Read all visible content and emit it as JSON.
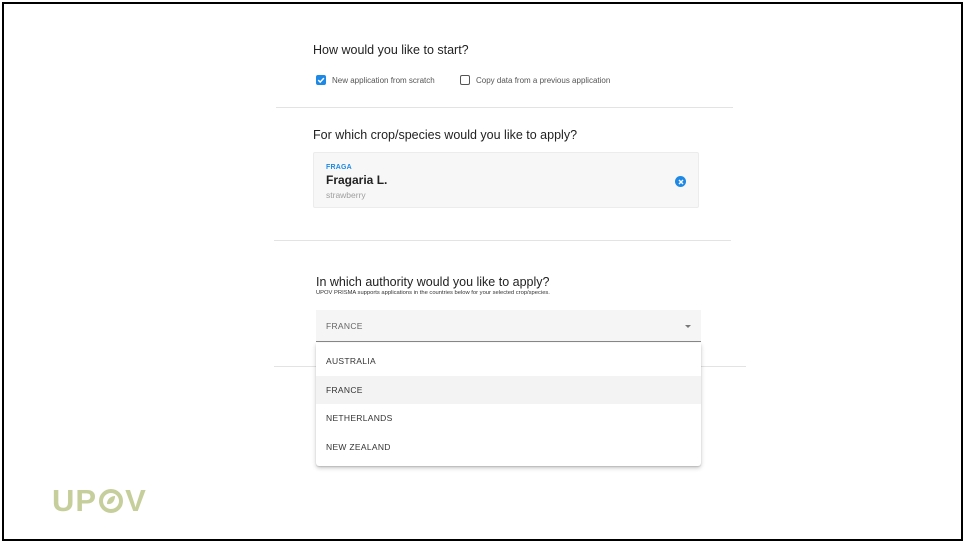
{
  "start": {
    "question": "How would you like to start?",
    "option_new": "New application from scratch",
    "option_copy": "Copy data from a previous application",
    "option_new_checked": true,
    "option_copy_checked": false
  },
  "crop": {
    "question": "For which crop/species would you like to apply?",
    "code": "FRAGA",
    "name": "Fragaria L.",
    "common_name": "strawberry",
    "clear_icon": "close-circle-icon"
  },
  "authority": {
    "question": "In which authority would you like to apply?",
    "subtitle": "UPOV PRISMA supports applications in the countries below for your selected crop/species.",
    "selected": "FRANCE",
    "options": [
      "AUSTRALIA",
      "FRANCE",
      "NETHERLANDS",
      "NEW ZEALAND"
    ]
  },
  "logo": {
    "left": "UP",
    "right": "V",
    "icon": "seed-o-icon"
  },
  "colors": {
    "accent": "#1e88e5",
    "logo": "#c6cf9c"
  }
}
